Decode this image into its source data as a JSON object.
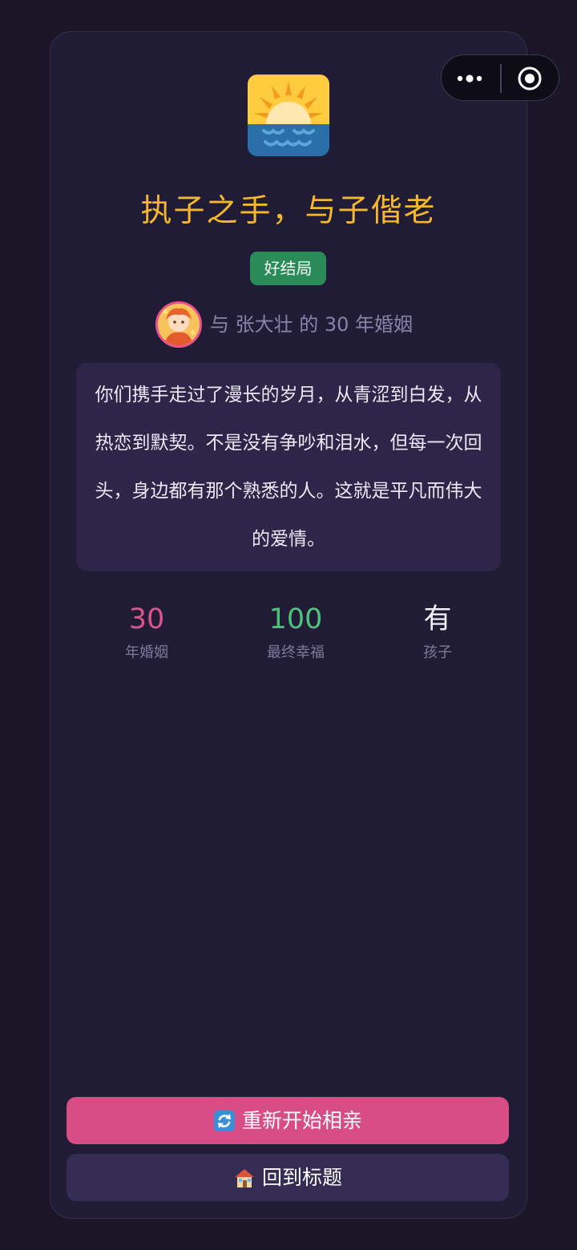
{
  "header": {
    "more_icon": "more-dots-icon",
    "close_icon": "target-circle-icon"
  },
  "result": {
    "icon": "sunrise-over-water-icon",
    "title": "执子之手，与子偕老",
    "badge": "好结局",
    "badge_color": "#2a8a58",
    "partner_line": "与 张大壮 的 30 年婚姻",
    "story": "你们携手走过了漫长的岁月，从青涩到白发，从热恋到默契。不是没有争吵和泪水，但每一次回头，身边都有那个熟悉的人。这就是平凡而伟大的爱情。"
  },
  "stats": [
    {
      "value": "30",
      "label": "年婚姻",
      "color": "#d9558b"
    },
    {
      "value": "100",
      "label": "最终幸福",
      "color": "#4cc27a"
    },
    {
      "value": "有",
      "label": "孩子",
      "color": "#f1eefa"
    }
  ],
  "actions": {
    "restart_label": "重新开始相亲",
    "restart_icon": "refresh-icon",
    "home_label": "回到标题",
    "home_icon": "house-icon"
  },
  "colors": {
    "background": "#1a1628",
    "card": "#211c36",
    "title": "#f4b72e",
    "primary_button": "#d84d86",
    "secondary_button": "#342c52"
  }
}
